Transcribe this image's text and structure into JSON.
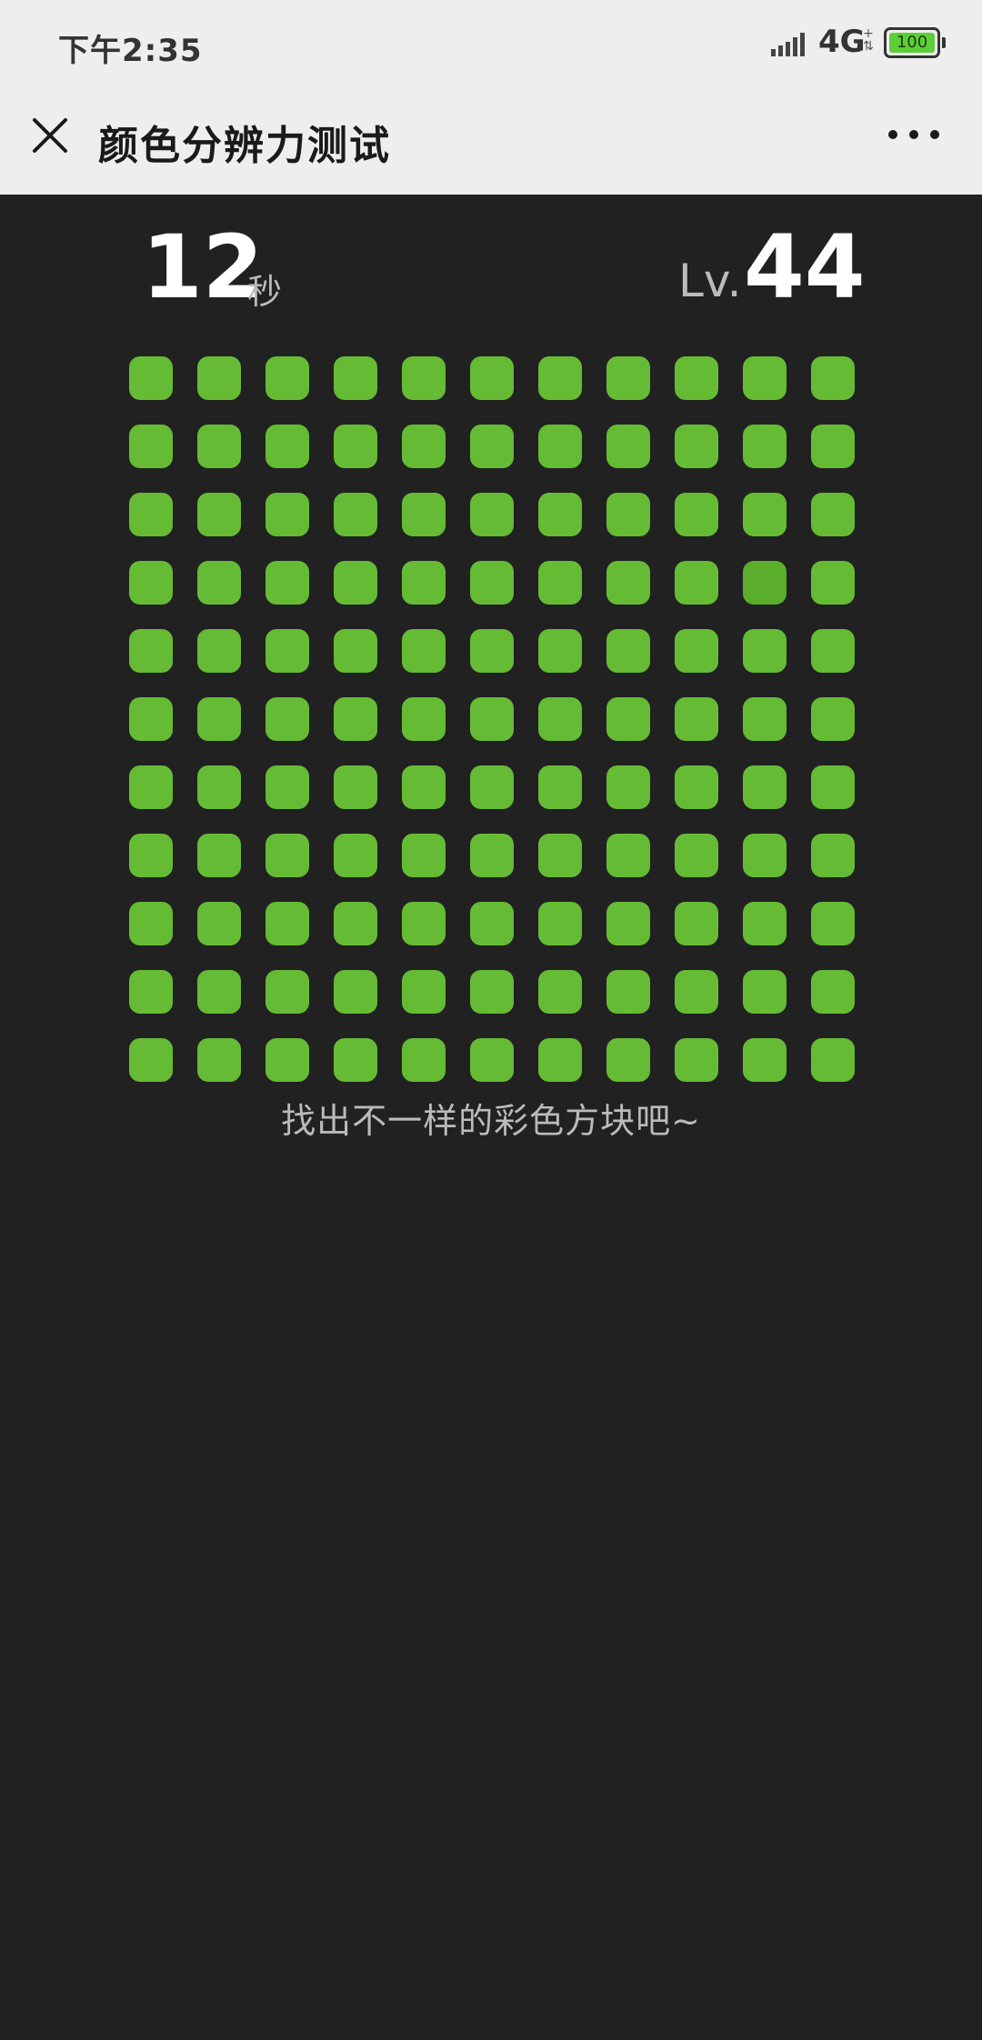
{
  "status_bar": {
    "time": "下午2:35",
    "network": "4G",
    "battery": "100"
  },
  "nav": {
    "title": "颜色分辨力测试"
  },
  "game": {
    "timer": "12",
    "timer_unit": "秒",
    "level_prefix": "Lv.",
    "level": "44",
    "hint": "找出不一样的彩色方块吧~",
    "grid": {
      "rows": 11,
      "cols": 11,
      "base_color": "#66bb35",
      "odd_color": "#5aae2b",
      "odd_row": 3,
      "odd_col": 9
    }
  },
  "colors": {
    "background": "#212121",
    "bar_background": "#eeeeee"
  }
}
